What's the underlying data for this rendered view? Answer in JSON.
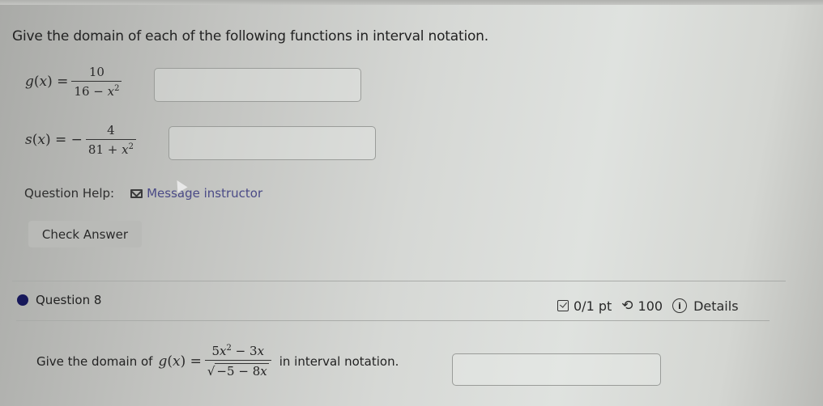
{
  "prompt": "Give the domain of each of the following functions in interval notation.",
  "functions": [
    {
      "name": "g",
      "var": "x",
      "sign": "",
      "numerator": "10",
      "denominator_const": "16",
      "denominator_op": "−",
      "denominator_var": "x",
      "denominator_exp": "2",
      "answer_value": ""
    },
    {
      "name": "s",
      "var": "x",
      "sign": "−",
      "numerator": "4",
      "denominator_const": "81",
      "denominator_op": "+",
      "denominator_var": "x",
      "denominator_exp": "2",
      "answer_value": ""
    }
  ],
  "help": {
    "label": "Question Help:",
    "link": "Message instructor",
    "icon": "mail-icon"
  },
  "check_answer_label": "Check Answer",
  "question8": {
    "title": "Question 8",
    "score": "0/1 pt",
    "retries": "100",
    "details_label": "Details",
    "text_before": "Give the domain of",
    "func_name": "g",
    "var": "x",
    "numerator": {
      "c1": "5",
      "v1": "x",
      "e1": "2",
      "op": "−",
      "c2": "3",
      "v2": "x"
    },
    "denominator": {
      "c1": "−5",
      "op": "−",
      "c2": "8",
      "v2": "x"
    },
    "text_after": "in interval notation.",
    "answer_value": ""
  },
  "colors": {
    "question_dot": "#17185a",
    "link": "#4a4a86",
    "button_bg": "#b9bab7"
  }
}
